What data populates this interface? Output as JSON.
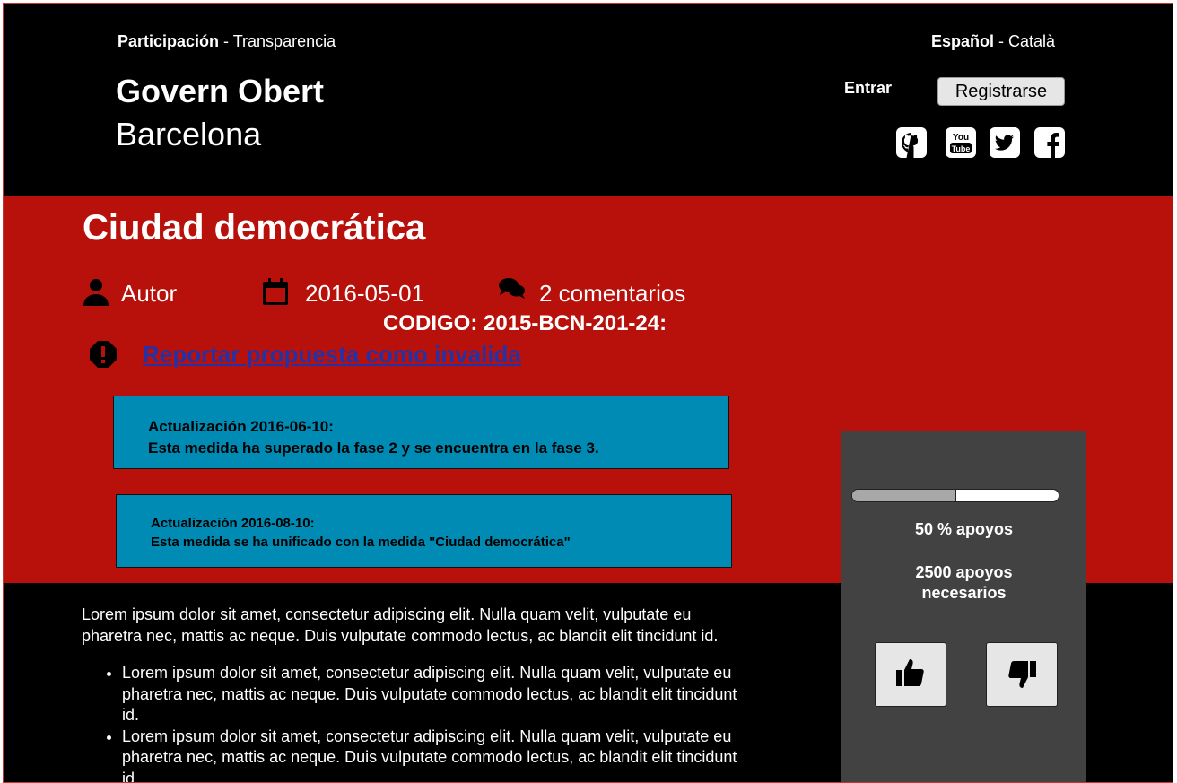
{
  "header": {
    "nav": [
      {
        "label": "Participación",
        "active": true
      },
      {
        "label": "Transparencia",
        "active": false
      }
    ],
    "nav_sep": " - ",
    "languages": [
      {
        "label": "Español",
        "active": true
      },
      {
        "label": "Català",
        "active": false
      }
    ],
    "brand_line1": "Govern Obert",
    "brand_line2": "Barcelona",
    "login_label": "Entrar",
    "register_label": "Registrarse",
    "social_icons": [
      "github-icon",
      "youtube-icon",
      "twitter-icon",
      "facebook-icon"
    ]
  },
  "proposal": {
    "title": "Ciudad democrática",
    "author": "Autor",
    "date": "2016-05-01",
    "comments": "2 comentarios",
    "codigo": "CODIGO: 2015-BCN-201-24:",
    "report_link": "Reportar propuesta como invalida",
    "updates": [
      {
        "heading": "Actualización 2016-06-10:",
        "text": "Esta medida ha superado la fase 2 y se encuentra en la fase 3."
      },
      {
        "heading": "Actualización 2016-08-10:",
        "text": "Esta medida se ha unificado con la medida \"Ciudad democrática\""
      }
    ]
  },
  "support": {
    "progress_fraction": 0.5,
    "percent_label": "50 % apoyos",
    "needed_line1": "2500 apoyos",
    "needed_line2": "necesarios"
  },
  "body": {
    "paragraph": "Lorem ipsum dolor sit amet, consectetur adipiscing elit. Nulla quam velit, vulputate eu pharetra nec, mattis ac neque. Duis vulputate commodo lectus, ac blandit elit tincidunt id.",
    "bullets": [
      "Lorem ipsum dolor sit amet, consectetur adipiscing elit. Nulla quam velit, vulputate eu pharetra nec, mattis ac neque. Duis vulputate commodo lectus, ac blandit elit tincidunt id.",
      "Lorem ipsum dolor sit amet, consectetur adipiscing elit. Nulla quam velit, vulputate eu pharetra nec, mattis ac neque. Duis vulputate commodo lectus, ac blandit elit tincidunt id."
    ]
  },
  "colors": {
    "header_bg": "#000000",
    "band_bg": "#b8100a",
    "update_bg": "#008bb4",
    "sidebar_bg": "#424242",
    "link": "#2432a8"
  }
}
